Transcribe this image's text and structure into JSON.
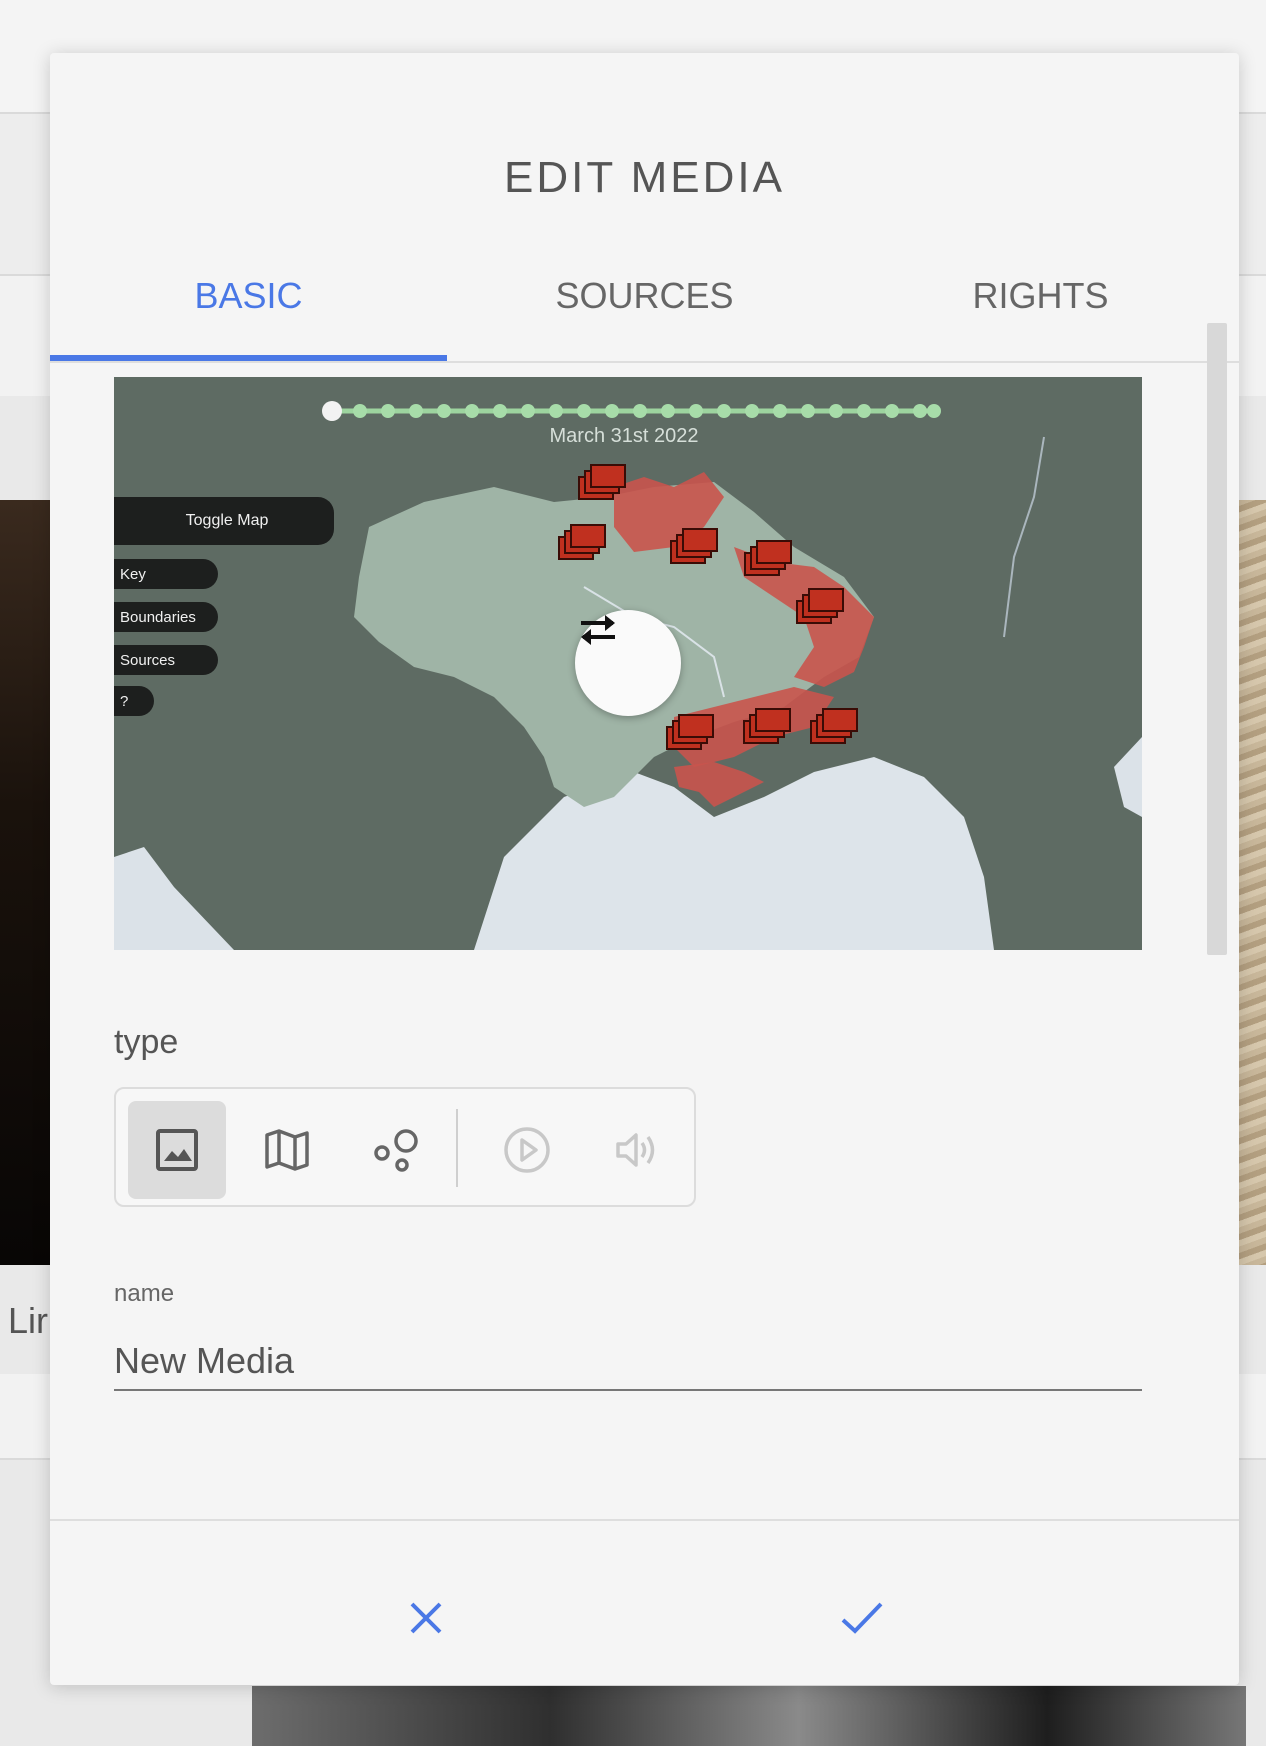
{
  "background": {
    "partial_text": "Lir"
  },
  "modal": {
    "title": "EDIT MEDIA",
    "tabs": [
      {
        "label": "BASIC",
        "active": true
      },
      {
        "label": "SOURCES",
        "active": false
      },
      {
        "label": "RIGHTS",
        "active": false
      }
    ],
    "preview": {
      "date": "March 31st 2022",
      "buttons": {
        "toggle_map": "Toggle Map",
        "key": "Key",
        "boundaries": "Boundaries",
        "sources": "Sources",
        "help": "?"
      },
      "swap_icon": "swap-arrows-icon"
    },
    "type": {
      "label": "type",
      "options": [
        {
          "icon": "image-icon",
          "selected": true,
          "enabled": true
        },
        {
          "icon": "map-icon",
          "selected": false,
          "enabled": true
        },
        {
          "icon": "graph-icon",
          "selected": false,
          "enabled": true
        },
        {
          "icon": "video-play-icon",
          "selected": false,
          "enabled": false
        },
        {
          "icon": "audio-volume-icon",
          "selected": false,
          "enabled": false
        }
      ]
    },
    "name": {
      "label": "name",
      "value": "New Media"
    },
    "footer": {
      "cancel_icon": "close-icon",
      "confirm_icon": "check-icon"
    }
  },
  "colors": {
    "accent": "#4a78e6",
    "occupied": "#c9544d",
    "marker": "#c0301f"
  }
}
